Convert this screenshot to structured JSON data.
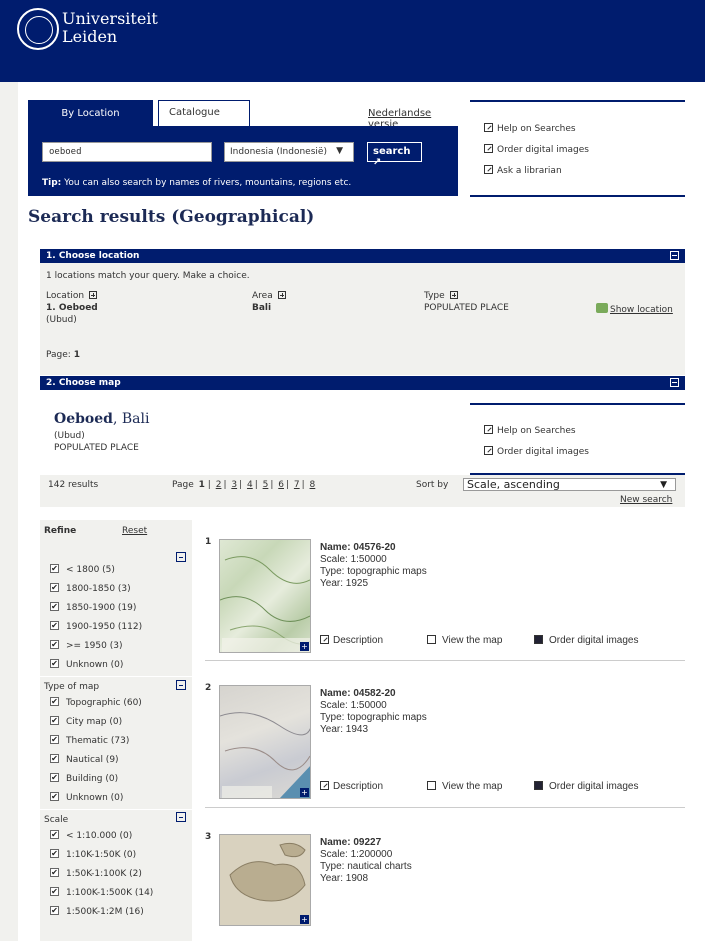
{
  "header": {
    "line1": "Universiteit",
    "line2": "Leiden"
  },
  "search": {
    "tab_location": "By Location",
    "tab_catalogue": "Catalogue",
    "nl_link": "Nederlandse versie",
    "query": "oeboed",
    "country": "Indonesia (Indonesië)",
    "search_label": "search ↗",
    "tip_bold": "Tip:",
    "tip_text": " You can also search by names of rivers, mountains, regions etc."
  },
  "side_links": [
    "Help on Searches",
    "Order digital images",
    "Ask a librarian"
  ],
  "page_title": "Search results (Geographical)",
  "section1": {
    "title": "1. Choose location",
    "match_text": "1 locations match your query. Make a choice.",
    "col_location": "Location",
    "col_area": "Area",
    "col_type": "Type",
    "row": {
      "name": "1. Oeboed",
      "alt": "(Ubud)",
      "area": "Bali",
      "type": "POPULATED PLACE",
      "show": "Show location"
    },
    "page_label": "Page:",
    "page_num": "1"
  },
  "section2": {
    "title": "2. Choose map",
    "place_bold": "Oeboed",
    "place_rest": ", Bali",
    "place_alt": "(Ubud)",
    "place_type": "POPULATED PLACE",
    "links": [
      "Help on Searches",
      "Order digital images"
    ]
  },
  "results_bar": {
    "count": "142 results",
    "page_label": "Page",
    "current": "1",
    "pages": [
      "2",
      "3",
      "4",
      "5",
      "6",
      "7",
      "8"
    ],
    "sort_label": "Sort by",
    "sort_value": "Scale, ascending",
    "new_search": "New search"
  },
  "refine": {
    "title": "Refine",
    "reset": "Reset",
    "period": [
      "< 1800 (5)",
      "1800-1850 (3)",
      "1850-1900 (19)",
      "1900-1950 (112)",
      ">= 1950 (3)",
      "Unknown (0)"
    ],
    "type_title": "Type of map",
    "types": [
      "Topographic (60)",
      "City map (0)",
      "Thematic (73)",
      "Nautical (9)",
      "Building (0)",
      "Unknown (0)"
    ],
    "scale_title": "Scale",
    "scales": [
      "< 1:10.000 (0)",
      "1:10K-1:50K (0)",
      "1:50K-1:100K (2)",
      "1:100K-1:500K (14)",
      "1:500K-1:2M (16)"
    ]
  },
  "results": [
    {
      "num": "1",
      "name": "Name: 04576-20",
      "scale": "Scale:  1:50000",
      "type": "Type:   topographic maps",
      "year": "Year:   1925"
    },
    {
      "num": "2",
      "name": "Name: 04582-20",
      "scale": "Scale:  1:50000",
      "type": "Type:   topographic maps",
      "year": "Year:   1943"
    },
    {
      "num": "3",
      "name": "Name: 09227",
      "scale": "Scale:  1:200000",
      "type": "Type:   nautical charts",
      "year": "Year:   1908"
    }
  ],
  "actions": {
    "description": "Description",
    "view": "View the map",
    "order": "Order digital images"
  }
}
